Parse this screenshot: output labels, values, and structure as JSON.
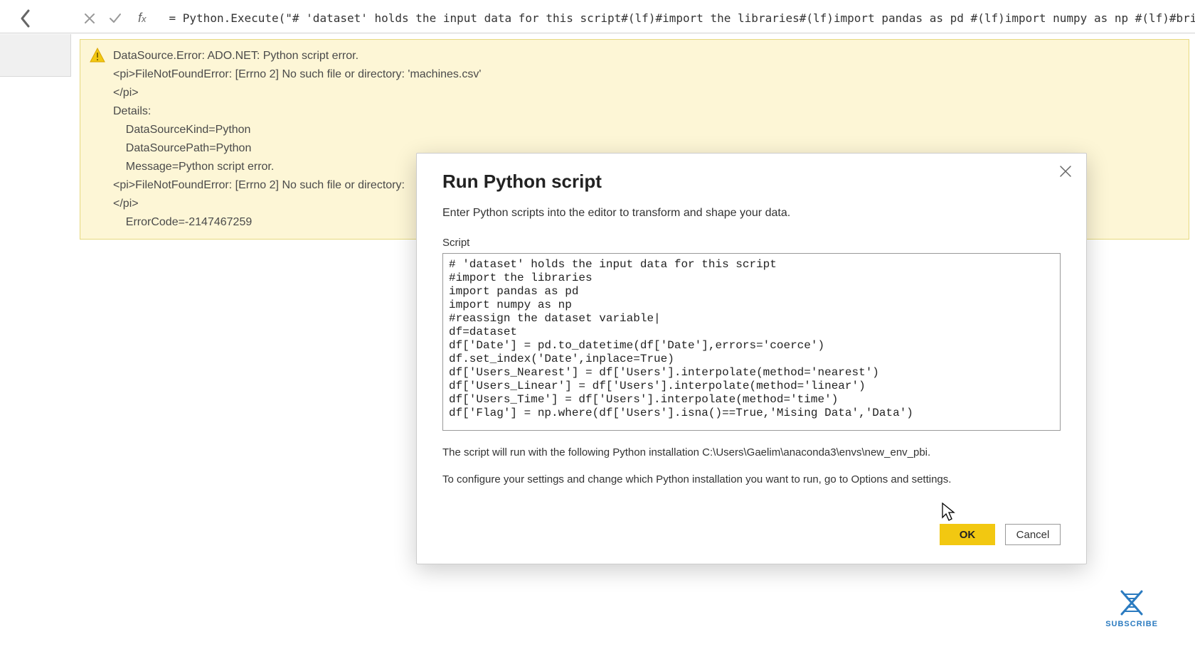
{
  "topbar": {
    "formula": "= Python.Execute(\"# 'dataset' holds the input data for this script#(lf)#import the libraries#(lf)import pandas as pd #(lf)import numpy as np #(lf)#bring in t"
  },
  "error": {
    "title": "DataSource.Error: ADO.NET: Python script error.",
    "body": "<pi>FileNotFoundError: [Errno 2] No such file or directory: 'machines.csv'\n</pi>\nDetails:\n    DataSourceKind=Python\n    DataSourcePath=Python\n    Message=Python script error.\n<pi>FileNotFoundError: [Errno 2] No such file or directory:\n</pi>\n    ErrorCode=-2147467259"
  },
  "dialog": {
    "title": "Run Python script",
    "subtitle": "Enter Python scripts into the editor to transform and shape your data.",
    "script_label": "Script",
    "script": "# 'dataset' holds the input data for this script\n#import the libraries\nimport pandas as pd\nimport numpy as np\n#reassign the dataset variable|\ndf=dataset\ndf['Date'] = pd.to_datetime(df['Date'],errors='coerce')\ndf.set_index('Date',inplace=True)\ndf['Users_Nearest'] = df['Users'].interpolate(method='nearest')\ndf['Users_Linear'] = df['Users'].interpolate(method='linear')\ndf['Users_Time'] = df['Users'].interpolate(method='time')\ndf['Flag'] = np.where(df['Users'].isna()==True,'Mising Data','Data')",
    "install_note1": "The script will run with the following Python installation C:\\Users\\Gaelim\\anaconda3\\envs\\new_env_pbi.",
    "install_note2": "To configure your settings and change which Python installation you want to run, go to Options and settings.",
    "ok": "OK",
    "cancel": "Cancel"
  },
  "subscribe": {
    "label": "SUBSCRIBE"
  }
}
